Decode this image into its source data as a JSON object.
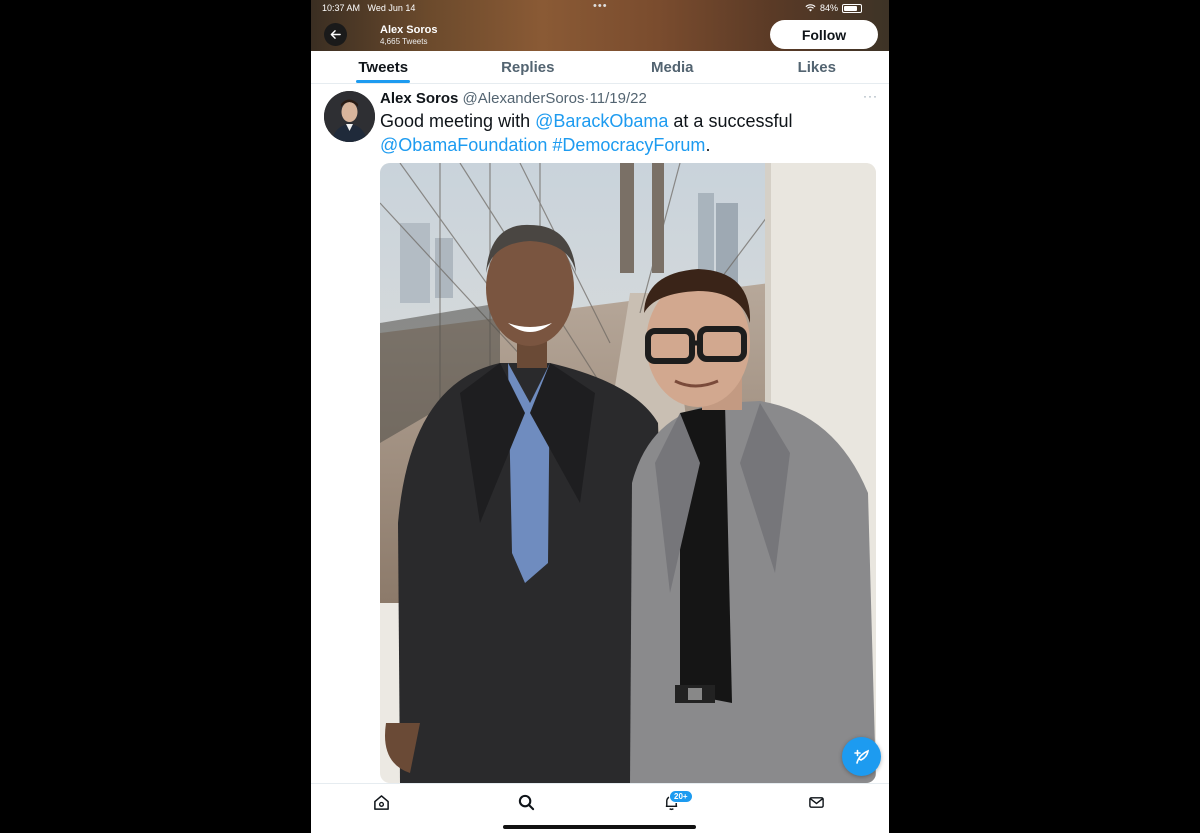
{
  "status_bar": {
    "time": "10:37 AM",
    "date": "Wed Jun 14",
    "battery": "84%",
    "battery_level": 0.84
  },
  "header": {
    "name": "Alex Soros",
    "tweet_count": "4,665 Tweets",
    "follow_label": "Follow"
  },
  "tabs": [
    {
      "label": "Tweets",
      "active": true
    },
    {
      "label": "Replies",
      "active": false
    },
    {
      "label": "Media",
      "active": false
    },
    {
      "label": "Likes",
      "active": false
    }
  ],
  "tweet": {
    "name": "Alex Soros",
    "handle": "@AlexanderSoros",
    "separator": "·",
    "date": "11/19/22",
    "text_1": "Good meeting with ",
    "mention_1": "@BarackObama",
    "text_2": " at a successful ",
    "mention_2": "@ObamaFoundation",
    "text_3": " ",
    "hashtag": "#DemocracyForum",
    "text_4": "."
  },
  "bottom_nav": {
    "notification_badge": "20+"
  },
  "colors": {
    "accent": "#1d9bf0",
    "text_primary": "#0f1419",
    "text_secondary": "#536471"
  }
}
